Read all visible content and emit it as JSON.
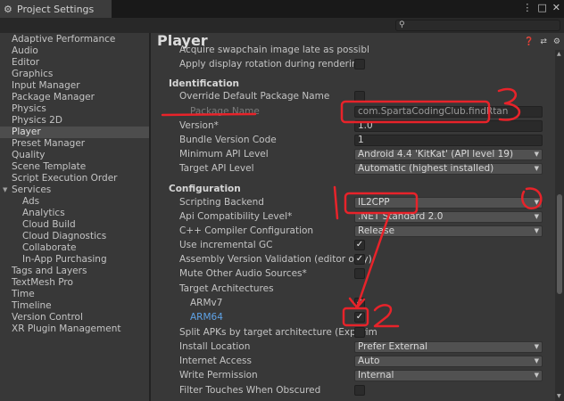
{
  "window": {
    "tab_title": "Project Settings",
    "menu_glyph": "⋮",
    "maximize_glyph": "□",
    "close_glyph": "✕"
  },
  "search": {
    "placeholder": "",
    "icon": "search-icon"
  },
  "sidebar": {
    "items": [
      {
        "label": "Adaptive Performance"
      },
      {
        "label": "Audio"
      },
      {
        "label": "Editor"
      },
      {
        "label": "Graphics"
      },
      {
        "label": "Input Manager"
      },
      {
        "label": "Package Manager"
      },
      {
        "label": "Physics"
      },
      {
        "label": "Physics 2D"
      },
      {
        "label": "Player"
      },
      {
        "label": "Preset Manager"
      },
      {
        "label": "Quality"
      },
      {
        "label": "Scene Template"
      },
      {
        "label": "Script Execution Order"
      },
      {
        "label": "Services"
      },
      {
        "label": "Ads"
      },
      {
        "label": "Analytics"
      },
      {
        "label": "Cloud Build"
      },
      {
        "label": "Cloud Diagnostics"
      },
      {
        "label": "Collaborate"
      },
      {
        "label": "In-App Purchasing"
      },
      {
        "label": "Tags and Layers"
      },
      {
        "label": "TextMesh Pro"
      },
      {
        "label": "Time"
      },
      {
        "label": "Timeline"
      },
      {
        "label": "Version Control"
      },
      {
        "label": "XR Plugin Management"
      }
    ],
    "selected": "Player"
  },
  "header": {
    "title": "Player"
  },
  "settings": {
    "acquire_swapchain": "Acquire swapchain image late as possibl",
    "apply_display_rotation": "Apply display rotation during rendering",
    "identification": "Identification",
    "override_package_name": "Override Default Package Name",
    "package_name_label": "Package Name",
    "package_name_value": "com.SpartaCodingClub.findRtan",
    "version_label": "Version*",
    "version_value": "1.0",
    "bundle_version_label": "Bundle Version Code",
    "bundle_version_value": "1",
    "min_api_label": "Minimum API Level",
    "min_api_value": "Android 4.4 'KitKat' (API level 19)",
    "target_api_label": "Target API Level",
    "target_api_value": "Automatic (highest installed)",
    "configuration": "Configuration",
    "scripting_backend_label": "Scripting Backend",
    "scripting_backend_value": "IL2CPP",
    "api_compat_label": "Api Compatibility Level*",
    "api_compat_value": ".NET Standard 2.0",
    "cpp_config_label": "C++ Compiler Configuration",
    "cpp_config_value": "Release",
    "incremental_gc_label": "Use incremental GC",
    "assembly_validation_label": "Assembly Version Validation (editor only)",
    "mute_audio_label": "Mute Other Audio Sources*",
    "target_arch_label": "Target Architectures",
    "armv7_label": "ARMv7",
    "arm64_label": "ARM64",
    "split_apks_label": "Split APKs by target architecture (Experim",
    "install_location_label": "Install Location",
    "install_location_value": "Prefer External",
    "internet_access_label": "Internet Access",
    "internet_access_value": "Auto",
    "write_permission_label": "Write Permission",
    "write_permission_value": "Internal",
    "filter_touches_label": "Filter Touches When Obscured"
  },
  "checkmark": "✓",
  "annotations": {
    "color": "#e8232a",
    "note_3": "3",
    "note_1": "1",
    "note_2": "2"
  }
}
